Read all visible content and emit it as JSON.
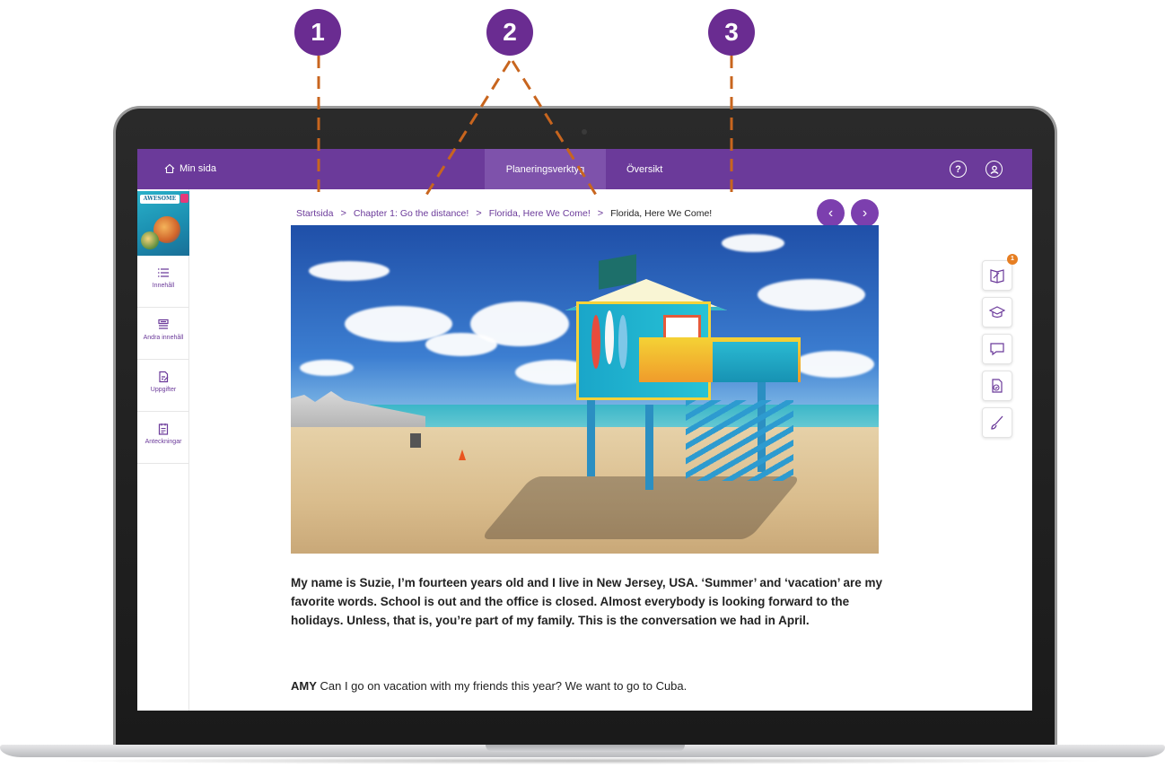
{
  "topbar": {
    "home_label": "Min sida",
    "tabs": [
      {
        "label": "Planeringsverktyg",
        "active": true
      },
      {
        "label": "Översikt",
        "active": false
      }
    ],
    "help_icon": "help-circle-icon",
    "user_icon": "user-circle-icon"
  },
  "sidebar": {
    "cover_title": "AWESOME",
    "cover_badge": "8",
    "items": [
      {
        "label": "Innehåll",
        "icon": "list-icon"
      },
      {
        "label": "Andra innehåll",
        "icon": "stack-icon"
      },
      {
        "label": "Uppgifter",
        "icon": "task-edit-icon"
      },
      {
        "label": "Anteckningar",
        "icon": "notes-icon"
      }
    ]
  },
  "breadcrumb": {
    "items": [
      "Startsida",
      "Chapter 1: Go the distance!",
      "Florida, Here We Come!"
    ],
    "current": "Florida, Here We Come!",
    "separator": ">"
  },
  "nav": {
    "prev": "‹",
    "next": "›"
  },
  "content": {
    "intro": "My name is Suzie, I’m fourteen years old and I live in New Jersey, USA. ‘Summer’ and ‘vacation’ are my favorite words. School is out and the office is closed. Almost everybody is looking forward to the holidays. Unless, that is, you’re part of my family. This is the conversation we had in April.",
    "dialog_speaker": "AMY",
    "dialog_text": " Can I go on vacation with my friends this year? We want to go to Cuba."
  },
  "tools": {
    "badge_count": "1",
    "items": [
      "book-pen-icon",
      "graduation-cap-icon",
      "comment-icon",
      "document-check-icon",
      "brush-icon"
    ]
  },
  "callouts": [
    "1",
    "2",
    "3"
  ],
  "colors": {
    "brand": "#6b3a9a",
    "accent": "#7c3fae",
    "callout": "#6a2c91",
    "leader": "#c8651e",
    "badge": "#e67e22"
  }
}
